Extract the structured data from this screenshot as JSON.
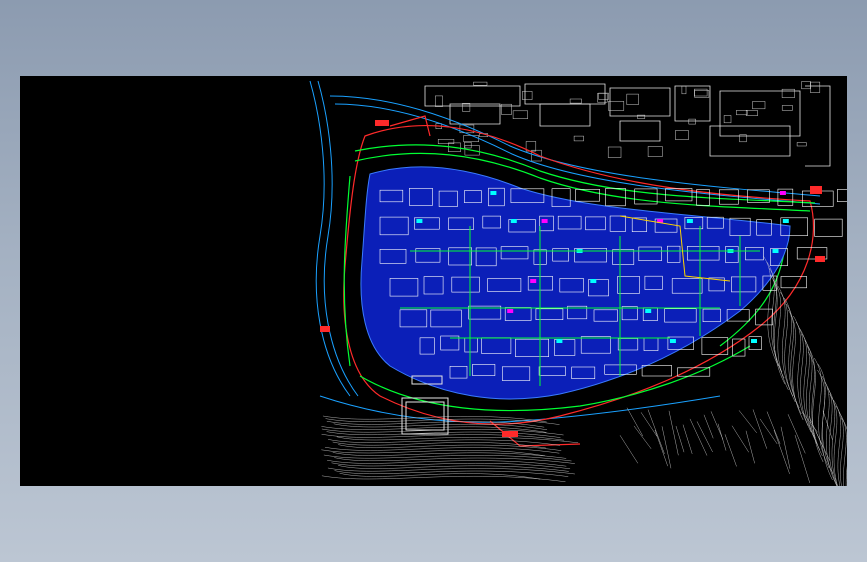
{
  "app": {
    "background": "#9aa8bb",
    "viewport_background": "#000000"
  },
  "drawing": {
    "subject": "site-plan",
    "colors": {
      "site_boundary": "#ff2a2a",
      "road": "#1aa1ff",
      "building_outline": "#ffffff",
      "landscape": "#00ff33",
      "parcel_fill": "#0b1fb8",
      "highlight": "#ff00ff",
      "accent_yellow": "#ffd400",
      "accent_cyan": "#00ffff",
      "contour": "#d8d8d8"
    }
  }
}
